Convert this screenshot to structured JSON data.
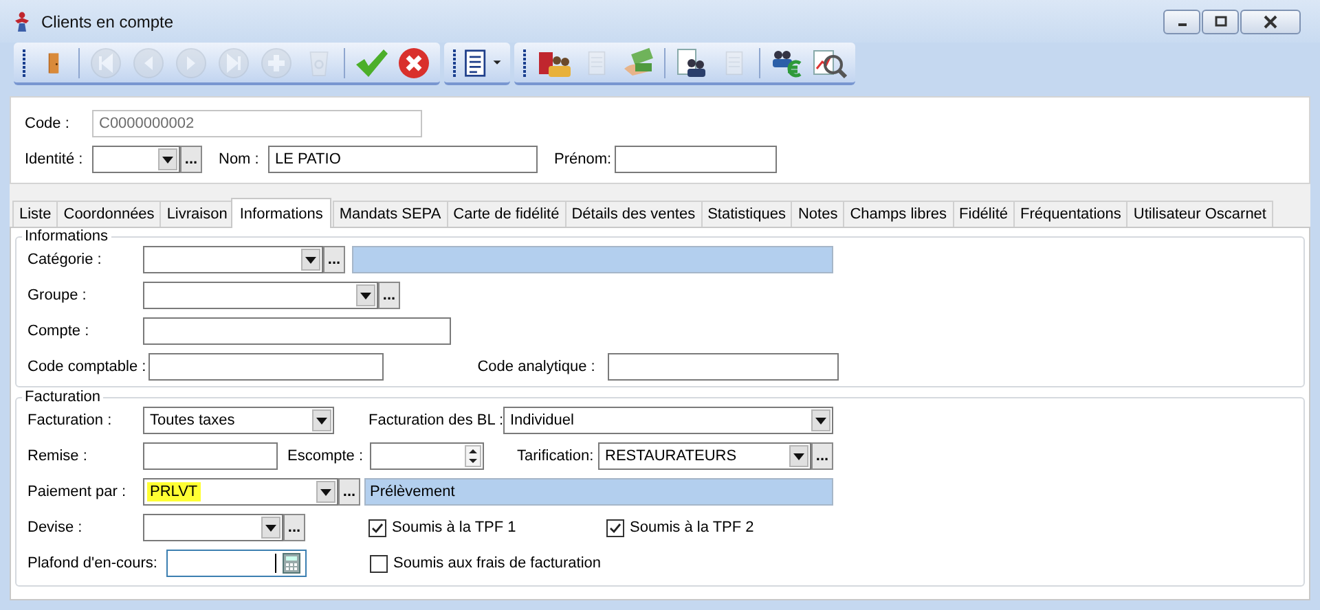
{
  "window": {
    "title": "Clients en compte"
  },
  "toolbar": {
    "groups": [
      [
        {
          "kind": "door",
          "disabled": false
        },
        {
          "kind": "sep"
        },
        {
          "kind": "first",
          "disabled": true
        },
        {
          "kind": "prev",
          "disabled": true
        },
        {
          "kind": "next",
          "disabled": true
        },
        {
          "kind": "last",
          "disabled": true
        },
        {
          "kind": "add",
          "disabled": true
        },
        {
          "kind": "recycle",
          "disabled": true
        },
        {
          "kind": "sep"
        },
        {
          "kind": "check",
          "disabled": false
        },
        {
          "kind": "cancel",
          "disabled": false
        }
      ],
      [
        {
          "kind": "report",
          "disabled": false
        }
      ],
      [
        {
          "kind": "people-folder",
          "disabled": false
        },
        {
          "kind": "document",
          "disabled": true
        },
        {
          "kind": "money",
          "disabled": false
        },
        {
          "kind": "sep"
        },
        {
          "kind": "people-sheet",
          "disabled": false
        },
        {
          "kind": "sheets",
          "disabled": true
        },
        {
          "kind": "sep"
        },
        {
          "kind": "people-euro",
          "disabled": false
        },
        {
          "kind": "chart-search",
          "disabled": false
        }
      ]
    ]
  },
  "header": {
    "code": {
      "label": "Code :",
      "value": "C0000000002",
      "disabled": true
    },
    "identite": {
      "label": "Identité :",
      "browse": "..."
    },
    "nom": {
      "label": "Nom :",
      "value": "LE PATIO"
    },
    "prenom": {
      "label": "Prénom:"
    }
  },
  "tabs": [
    {
      "label": "Liste",
      "selected": false
    },
    {
      "label": "Coordonnées",
      "selected": false
    },
    {
      "label": "Livraison",
      "selected": false
    },
    {
      "label": "Informations",
      "selected": true
    },
    {
      "label": "Mandats SEPA",
      "selected": false
    },
    {
      "label": "Carte de fidélité",
      "selected": false
    },
    {
      "label": "Détails des ventes",
      "selected": false
    },
    {
      "label": "Statistiques",
      "selected": false
    },
    {
      "label": "Notes",
      "selected": false
    },
    {
      "label": "Champs libres",
      "selected": false
    },
    {
      "label": "Fidélité",
      "selected": false
    },
    {
      "label": "Fréquentations",
      "selected": false
    },
    {
      "label": "Utilisateur Oscarnet",
      "selected": false
    }
  ],
  "informations": {
    "title": "Informations",
    "categorie": {
      "label": "Catégorie :",
      "browse": "..."
    },
    "groupe": {
      "label": "Groupe :",
      "browse": "..."
    },
    "compte": {
      "label": "Compte :"
    },
    "code_comptable": {
      "label": "Code comptable :"
    },
    "code_analytique": {
      "label": "Code analytique :"
    }
  },
  "facturation": {
    "title": "Facturation",
    "facturation": {
      "label": "Facturation :",
      "value": "Toutes taxes"
    },
    "facturation_bl": {
      "label": "Facturation des BL :",
      "value": "Individuel"
    },
    "remise": {
      "label": "Remise :"
    },
    "escompte": {
      "label": "Escompte :"
    },
    "tarification": {
      "label": "Tarification:",
      "value": "RESTAURATEURS",
      "browse": "..."
    },
    "paiement": {
      "label": "Paiement par :",
      "value": "PRLVT",
      "highlighted": true,
      "browse": "...",
      "description": "Prélèvement"
    },
    "devise": {
      "label": "Devise :",
      "browse": "..."
    },
    "plafond": {
      "label": "Plafond d'en-cours:"
    },
    "checkboxes": [
      {
        "label": "Soumis à la TPF 1",
        "checked": true
      },
      {
        "label": "Soumis à la TPF 2",
        "checked": true
      },
      {
        "label": "Soumis aux frais de facturation",
        "checked": false
      }
    ]
  }
}
